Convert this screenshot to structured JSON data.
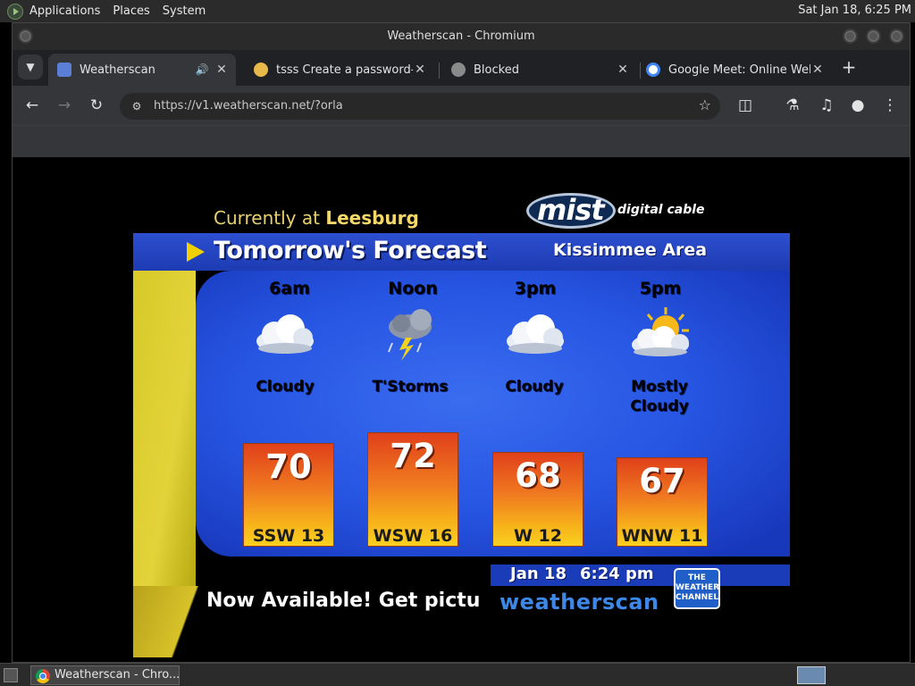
{
  "top_panel": {
    "menus": [
      "Applications",
      "Places",
      "System"
    ],
    "clock": "Sat Jan 18,  6:25 PM"
  },
  "window": {
    "title": "Weatherscan - Chromium"
  },
  "tabs": [
    {
      "title": "Weatherscan",
      "favicon_color": "#5b7fd6"
    },
    {
      "title": "tsss Create a password-p",
      "favicon_color": "#e8b84a"
    },
    {
      "title": "Blocked",
      "favicon_color": "#8a8a8a"
    },
    {
      "title": "Google Meet: Online Web",
      "favicon_color": "#ffffff"
    }
  ],
  "toolbar": {
    "url": "https://v1.weatherscan.net/?orla"
  },
  "weatherscan": {
    "currently_prefix": "Currently at",
    "currently_city": "Leesburg",
    "sponsor_name": "mist",
    "sponsor_tagline": "digital cable",
    "forecast_title": "Tomorrow's Forecast",
    "area": "Kissimmee Area",
    "periods": [
      {
        "time": "6am",
        "condition": "Cloudy",
        "condition_line2": "",
        "icon": "cloud-icon",
        "temp": "70",
        "wind": "SSW 13"
      },
      {
        "time": "Noon",
        "condition": "T'Storms",
        "condition_line2": "",
        "icon": "thunderstorm-icon",
        "temp": "72",
        "wind": "WSW 16"
      },
      {
        "time": "3pm",
        "condition": "Cloudy",
        "condition_line2": "",
        "icon": "cloud-icon",
        "temp": "68",
        "wind": "W 12"
      },
      {
        "time": "5pm",
        "condition": "Mostly",
        "condition_line2": "Cloudy",
        "icon": "mostly-cloudy-icon",
        "temp": "67",
        "wind": "WNW 11"
      }
    ],
    "date": "Jan 18",
    "time": "6:24 pm",
    "crawl": "Now Available! Get pictur",
    "brand": "weatherscan",
    "twc_logo": [
      "THE",
      "WEATHER",
      "CHANNEL"
    ]
  },
  "taskbar": {
    "task_label": "Weatherscan - Chro..."
  }
}
